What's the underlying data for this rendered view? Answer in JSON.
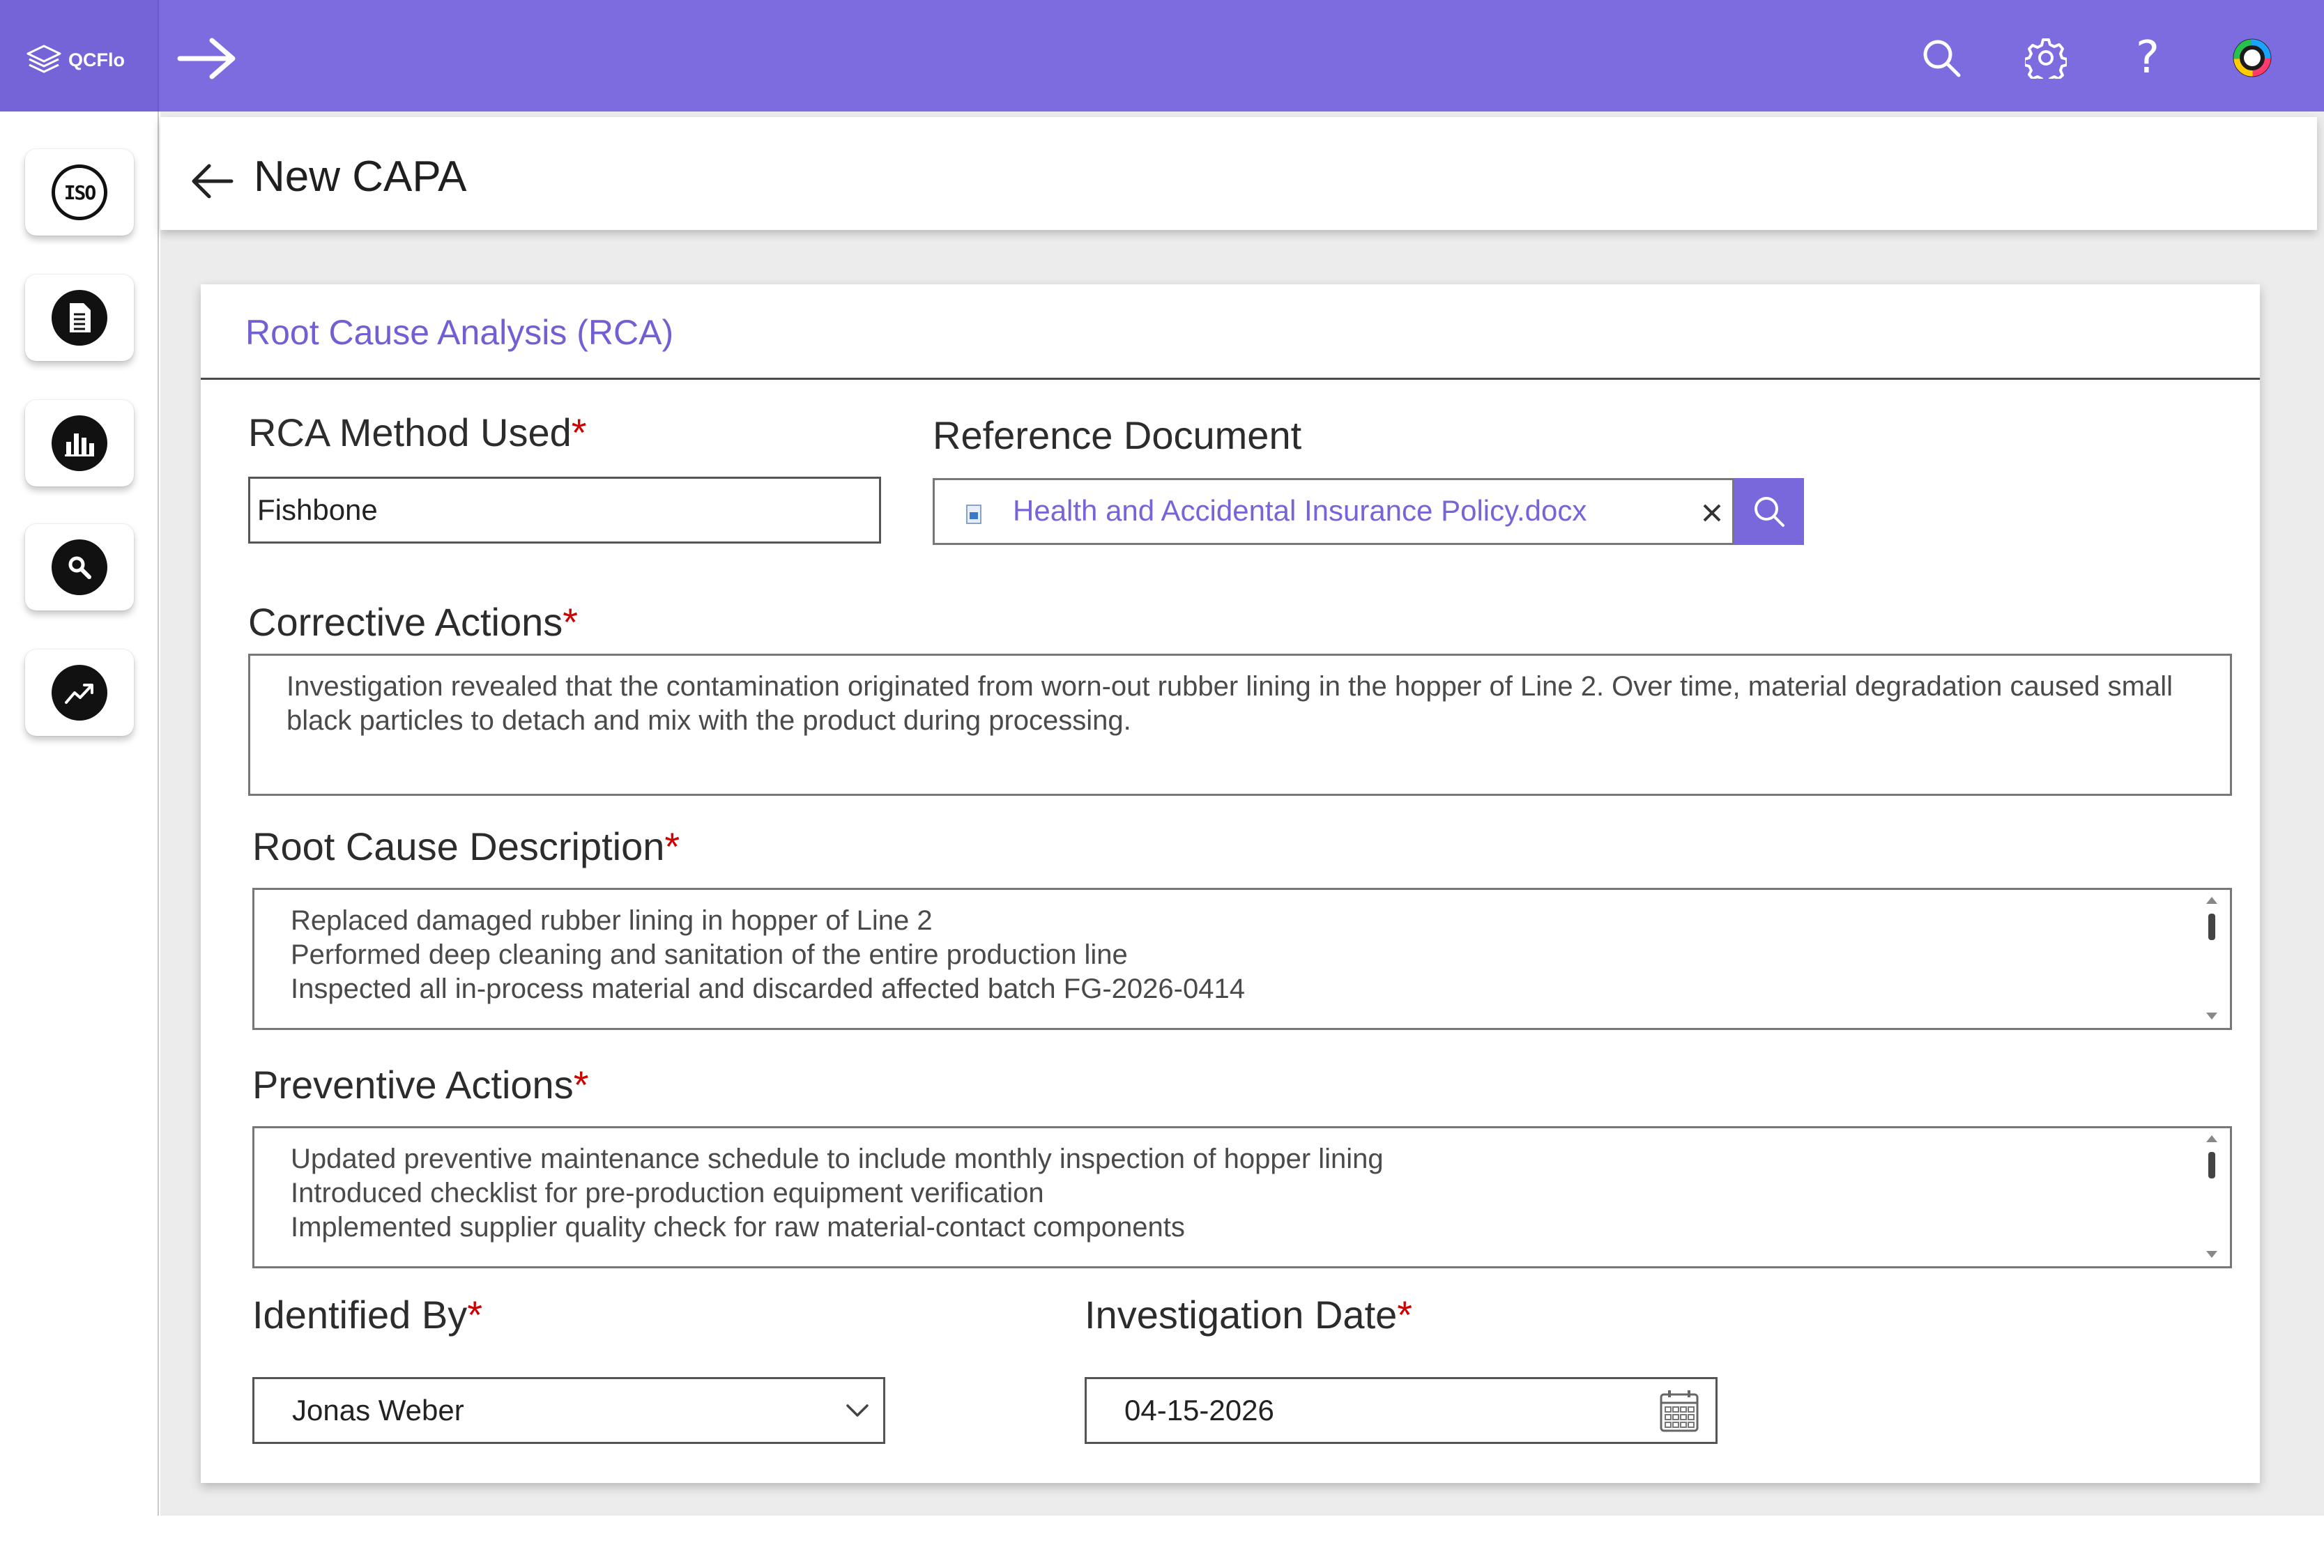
{
  "app": {
    "logo_text": "QCFlo",
    "brand_color": "#7d6be0"
  },
  "topbar": {
    "nav_icon": "arrow-right-icon",
    "icons": [
      "search-icon",
      "gear-icon",
      "help-icon",
      "avatar-icon"
    ],
    "help_glyph": "?"
  },
  "sidebar": {
    "items": [
      {
        "icon": "iso-icon",
        "glyph": "ISO"
      },
      {
        "icon": "document-icon"
      },
      {
        "icon": "bar-chart-icon"
      },
      {
        "icon": "magnifier-icon"
      },
      {
        "icon": "trend-up-icon"
      }
    ]
  },
  "header": {
    "title": "New CAPA"
  },
  "form": {
    "section_title": "Root Cause Analysis (RCA)",
    "rca_method": {
      "label": "RCA Method Used",
      "required": "*",
      "value": "Fishbone"
    },
    "reference_document": {
      "label": "Reference Document",
      "value": "Health and Accidental Insurance Policy.docx"
    },
    "corrective_actions": {
      "label": "Corrective Actions",
      "required": "*",
      "lines": [
        "Investigation revealed that the contamination originated from worn-out rubber lining in the hopper of Line 2. Over time, material degradation caused small",
        "black particles to detach and mix with the product during processing."
      ]
    },
    "root_cause_description": {
      "label": "Root Cause Description",
      "required": "*",
      "lines": [
        "Replaced damaged rubber lining in hopper of Line 2",
        "Performed deep cleaning and sanitation of the entire production line",
        "Inspected all in-process material and discarded affected batch FG-2026-0414"
      ]
    },
    "preventive_actions": {
      "label": "Preventive Actions",
      "required": "*",
      "lines": [
        "Updated preventive maintenance schedule to include monthly inspection of hopper lining",
        "Introduced checklist for pre-production equipment verification",
        "Implemented supplier quality check for raw material-contact components"
      ]
    },
    "identified_by": {
      "label": "Identified By",
      "required": "*",
      "value": "Jonas Weber"
    },
    "investigation_date": {
      "label": "Investigation Date",
      "required": "*",
      "value": "04-15-2026"
    }
  }
}
